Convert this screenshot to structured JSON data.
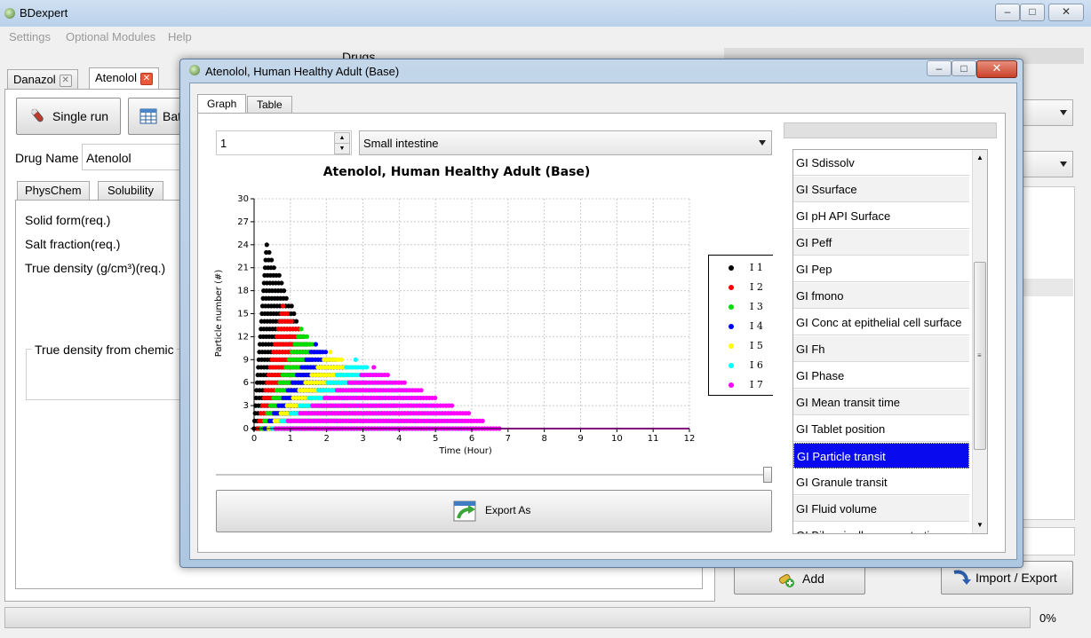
{
  "app": {
    "title": "BDexpert"
  },
  "menu": {
    "items": [
      "Settings",
      "Optional Modules",
      "Help"
    ]
  },
  "main": {
    "doc_tabs": [
      "Danazol",
      "Atenolol"
    ],
    "heading": "Drugs",
    "single_run_label": "Single run",
    "batch_label": "Bat",
    "drug_name_label": "Drug Name",
    "drug_name_value": "Atenolol",
    "sub_tabs": [
      "PhysChem",
      "Solubility"
    ],
    "props": [
      "Solid form(req.)",
      "Salt fraction(req.)",
      "True density (g/cm³)(req.)"
    ],
    "group_label": "True density from chemic",
    "add_label": "Add",
    "import_export_label": "Import / Export",
    "progress": "0%"
  },
  "dialog": {
    "title": "Atenolol, Human Healthy Adult (Base)",
    "tabs": [
      "Graph",
      "Table"
    ],
    "spin_value": "1",
    "segment": "Small intestine",
    "export_label": "Export As",
    "list_items": [
      "GI Sdissolv",
      "GI Ssurface",
      "GI pH API Surface",
      "GI Peff",
      "GI Pep",
      "GI fmono",
      "GI Conc at epithelial cell surface",
      "GI Fh",
      "GI Phase",
      "GI Mean transit time",
      "GI Tablet position",
      "GI Particle transit",
      "GI Granule transit",
      "GI Fluid volume",
      "GI Bile micelle concentration"
    ],
    "selected_item": "GI Particle transit"
  },
  "chart_data": {
    "type": "scatter",
    "title": "Atenolol, Human Healthy Adult (Base)",
    "xlabel": "Time (Hour)",
    "ylabel": "Particle number (#)",
    "xlim": [
      0,
      12
    ],
    "ylim": [
      0,
      30
    ],
    "xticks": [
      0,
      1,
      2,
      3,
      4,
      5,
      6,
      7,
      8,
      9,
      10,
      11,
      12
    ],
    "yticks": [
      0,
      3,
      6,
      9,
      12,
      15,
      18,
      21,
      24,
      27,
      30
    ],
    "grid": true,
    "legend_position": "right",
    "series": [
      {
        "name": "I 1",
        "color": "#000000",
        "start": 0.0,
        "peak_t": 0.35,
        "peak_n": 24,
        "end": 2.4
      },
      {
        "name": "I 2",
        "color": "#ff0000",
        "start": 0.1,
        "peak_t": 0.8,
        "peak_n": 16,
        "end": 3.2
      },
      {
        "name": "I 3",
        "color": "#00dd00",
        "start": 0.2,
        "peak_t": 1.3,
        "peak_n": 13,
        "end": 4.0
      },
      {
        "name": "I 4",
        "color": "#0000ff",
        "start": 0.3,
        "peak_t": 1.7,
        "peak_n": 11,
        "end": 4.8
      },
      {
        "name": "I 5",
        "color": "#ffff00",
        "start": 0.4,
        "peak_t": 2.1,
        "peak_n": 10,
        "end": 5.6
      },
      {
        "name": "I 6",
        "color": "#00ffff",
        "start": 0.5,
        "peak_t": 2.8,
        "peak_n": 9,
        "end": 6.2
      },
      {
        "name": "I 7",
        "color": "#ff00ff",
        "start": 0.6,
        "peak_t": 3.3,
        "peak_n": 8,
        "end": 6.8
      }
    ]
  }
}
